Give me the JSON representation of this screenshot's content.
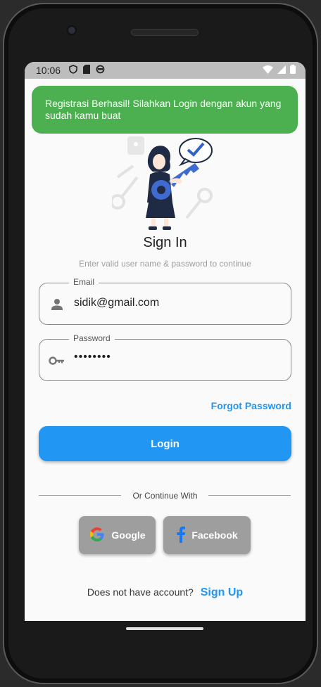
{
  "status_bar": {
    "time": "10:06"
  },
  "snackbar": {
    "message": "Registrasi Berhasil! Silahkan Login dengan akun yang sudah kamu buat"
  },
  "header": {
    "title": "Sign In",
    "subtitle": "Enter valid user name & password to continue"
  },
  "email_field": {
    "label": "Email",
    "value": "sidik@gmail.com",
    "icon": "person-icon"
  },
  "password_field": {
    "label": "Password",
    "value": "••••••••",
    "icon": "key-icon"
  },
  "forgot_password_label": "Forgot Password",
  "login_button_label": "Login",
  "divider_text": "Or Continue With",
  "social": {
    "google_label": "Google",
    "facebook_label": "Facebook"
  },
  "signup": {
    "prompt": "Does not have account?",
    "link_label": "Sign Up"
  },
  "colors": {
    "accent": "#2196f3",
    "snackbar": "#4caf50",
    "social_button": "#9e9e9e"
  }
}
